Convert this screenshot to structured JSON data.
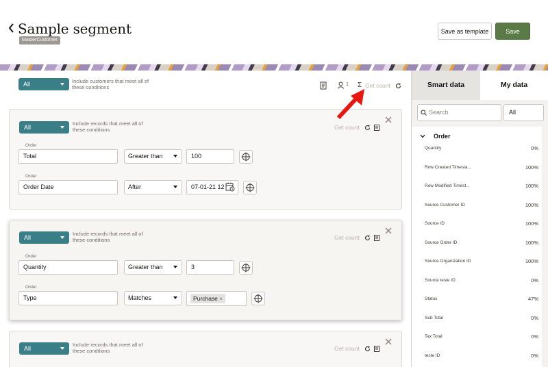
{
  "header": {
    "title": "Sample segment",
    "badge": "MasterCustomer",
    "save_template_label": "Save as template",
    "save_label": "Save"
  },
  "top_filter": {
    "select_value": "All",
    "hint": "Include customers that meet all of these conditions",
    "count_badge": "1",
    "get_count_label": "Get count"
  },
  "cards": [
    {
      "select_value": "All",
      "hint": "Include records that meet all of these conditions",
      "get_count_label": "Get count",
      "rows": [
        {
          "group": "Order",
          "attribute": "Total",
          "operator": "Greater than",
          "value": "100"
        },
        {
          "group": "Order",
          "attribute": "Order Date",
          "operator": "After",
          "value": "07-01-21 12"
        }
      ]
    },
    {
      "select_value": "All",
      "hint": "Include records that meet all of these conditions",
      "get_count_label": "Get count",
      "rows": [
        {
          "group": "Order",
          "attribute": "Quantity",
          "operator": "Greater than",
          "value": "3"
        },
        {
          "group": "Order",
          "attribute": "Type",
          "operator": "Matches",
          "chip": "Purchase"
        }
      ]
    },
    {
      "select_value": "All",
      "hint": "Include records that meet all of these conditions",
      "get_count_label": "Get count"
    }
  ],
  "side": {
    "tabs": [
      "Smart data",
      "My data"
    ],
    "search_placeholder": "Search",
    "filter_value": "All",
    "group": "Order",
    "items": [
      {
        "name": "Quantity",
        "value": "0%"
      },
      {
        "name": "Row Created Timesta...",
        "value": "100%"
      },
      {
        "name": "Row Modified Timest...",
        "value": "100%"
      },
      {
        "name": "Source Customer ID",
        "value": "100%"
      },
      {
        "name": "Source ID",
        "value": "100%"
      },
      {
        "name": "Source Order ID",
        "value": "100%"
      },
      {
        "name": "Source Organization ID",
        "value": "100%"
      },
      {
        "name": "Source teste ID",
        "value": "0%"
      },
      {
        "name": "Status",
        "value": "47%"
      },
      {
        "name": "Sub Total",
        "value": "0%"
      },
      {
        "name": "Tax Total",
        "value": "0%"
      },
      {
        "name": "teste ID",
        "value": "0%"
      }
    ]
  },
  "colors": {
    "accent_teal": "#3a7e87",
    "save_green": "#5a7a47",
    "annotation_red": "#e8170f"
  }
}
